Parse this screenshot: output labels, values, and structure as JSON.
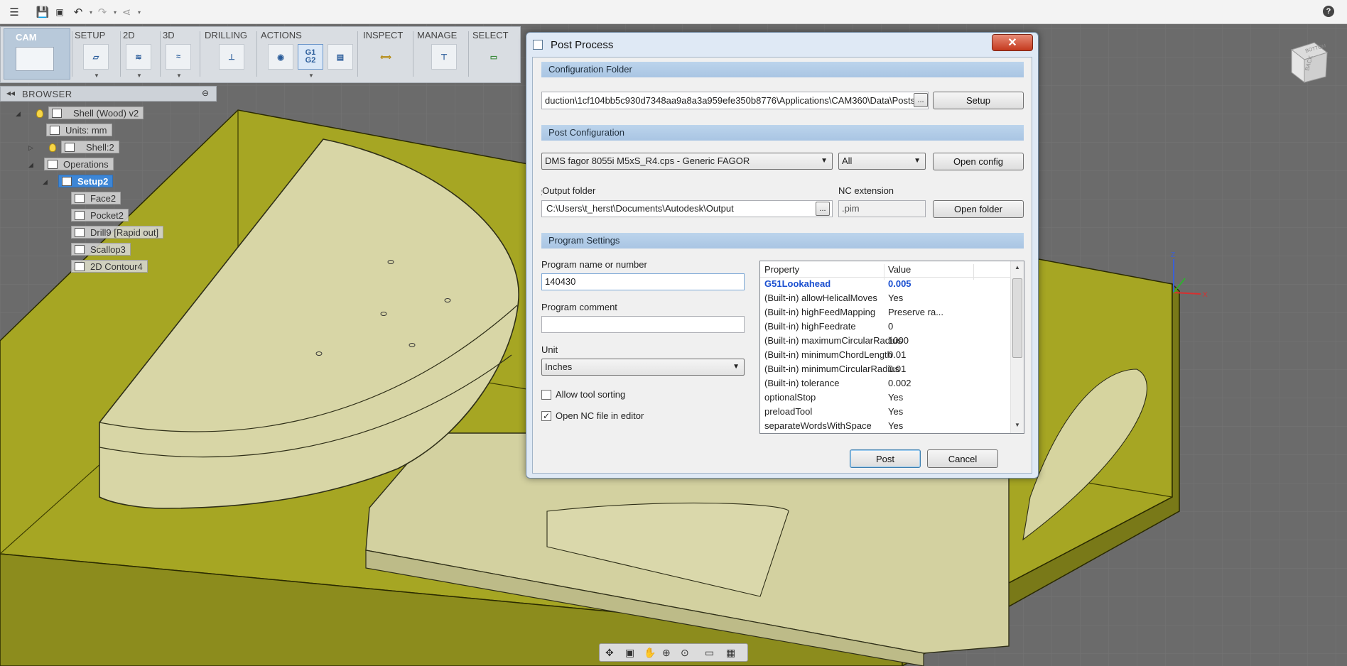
{
  "ribbon": {
    "workspace": "CAM",
    "groups": [
      "SETUP",
      "2D",
      "3D",
      "DRILLING",
      "ACTIONS",
      "INSPECT",
      "MANAGE",
      "SELECT"
    ],
    "g1g2": "G1\nG2"
  },
  "browser": {
    "title": "BROWSER",
    "items": [
      "Shell (Wood) v2",
      "Units: mm",
      "Shell:2",
      "Operations",
      "Setup2",
      "Face2",
      "Pocket2",
      "Drill9 [Rapid out]",
      "Scallop3",
      "2D Contour4"
    ]
  },
  "viewcube": {
    "back": "BACK",
    "bottom": "BOTTOM"
  },
  "dialog": {
    "title": "Post Process",
    "close_label": "✕",
    "config_folder": {
      "header": "Configuration Folder",
      "path": "duction\\1cf104bb5c930d7348aa9a8a3a959efe350b8776\\Applications\\CAM360\\Data\\Posts",
      "browse_label": "...",
      "setup_label": "Setup"
    },
    "post_config": {
      "header": "Post Configuration",
      "post": "DMS fagor 8055i M5xS_R4.cps - Generic FAGOR",
      "filter": "All",
      "open_config_label": "Open config",
      "output_folder_label": "Output folder",
      "output_folder": "C:\\Users\\t_herst\\Documents\\Autodesk\\Output",
      "browse_label": "...",
      "nc_ext_label": "NC extension",
      "nc_ext": ".pim",
      "open_folder_label": "Open folder"
    },
    "program_settings": {
      "header": "Program Settings",
      "name_label": "Program name or number",
      "name_value": "140430",
      "comment_label": "Program comment",
      "comment_value": "",
      "unit_label": "Unit",
      "unit_value": "Inches",
      "allow_sorting_label": "Allow tool sorting",
      "allow_sorting_checked": false,
      "open_nc_label": "Open NC file in editor",
      "open_nc_checked": true
    },
    "properties": {
      "col_property": "Property",
      "col_value": "Value",
      "rows": [
        {
          "k": "G51Lookahead",
          "v": "0.005"
        },
        {
          "k": "(Built-in) allowHelicalMoves",
          "v": "Yes"
        },
        {
          "k": "(Built-in) highFeedMapping",
          "v": "Preserve ra..."
        },
        {
          "k": "(Built-in) highFeedrate",
          "v": "0"
        },
        {
          "k": "(Built-in) maximumCircularRadius",
          "v": "1000"
        },
        {
          "k": "(Built-in) minimumChordLength",
          "v": "0.01"
        },
        {
          "k": "(Built-in) minimumCircularRadius",
          "v": "0.01"
        },
        {
          "k": "(Built-in) tolerance",
          "v": "0.002"
        },
        {
          "k": "optionalStop",
          "v": "Yes"
        },
        {
          "k": "preloadTool",
          "v": "Yes"
        },
        {
          "k": "separateWordsWithSpace",
          "v": "Yes"
        }
      ]
    },
    "post_label": "Post",
    "cancel_label": "Cancel"
  },
  "colors": {
    "stock": "#a6a623",
    "part": "#d8d6a6",
    "dialog_frame": "#dfe9f5",
    "section_header": "#b4cde8",
    "highlight": "#1a4fd0"
  }
}
